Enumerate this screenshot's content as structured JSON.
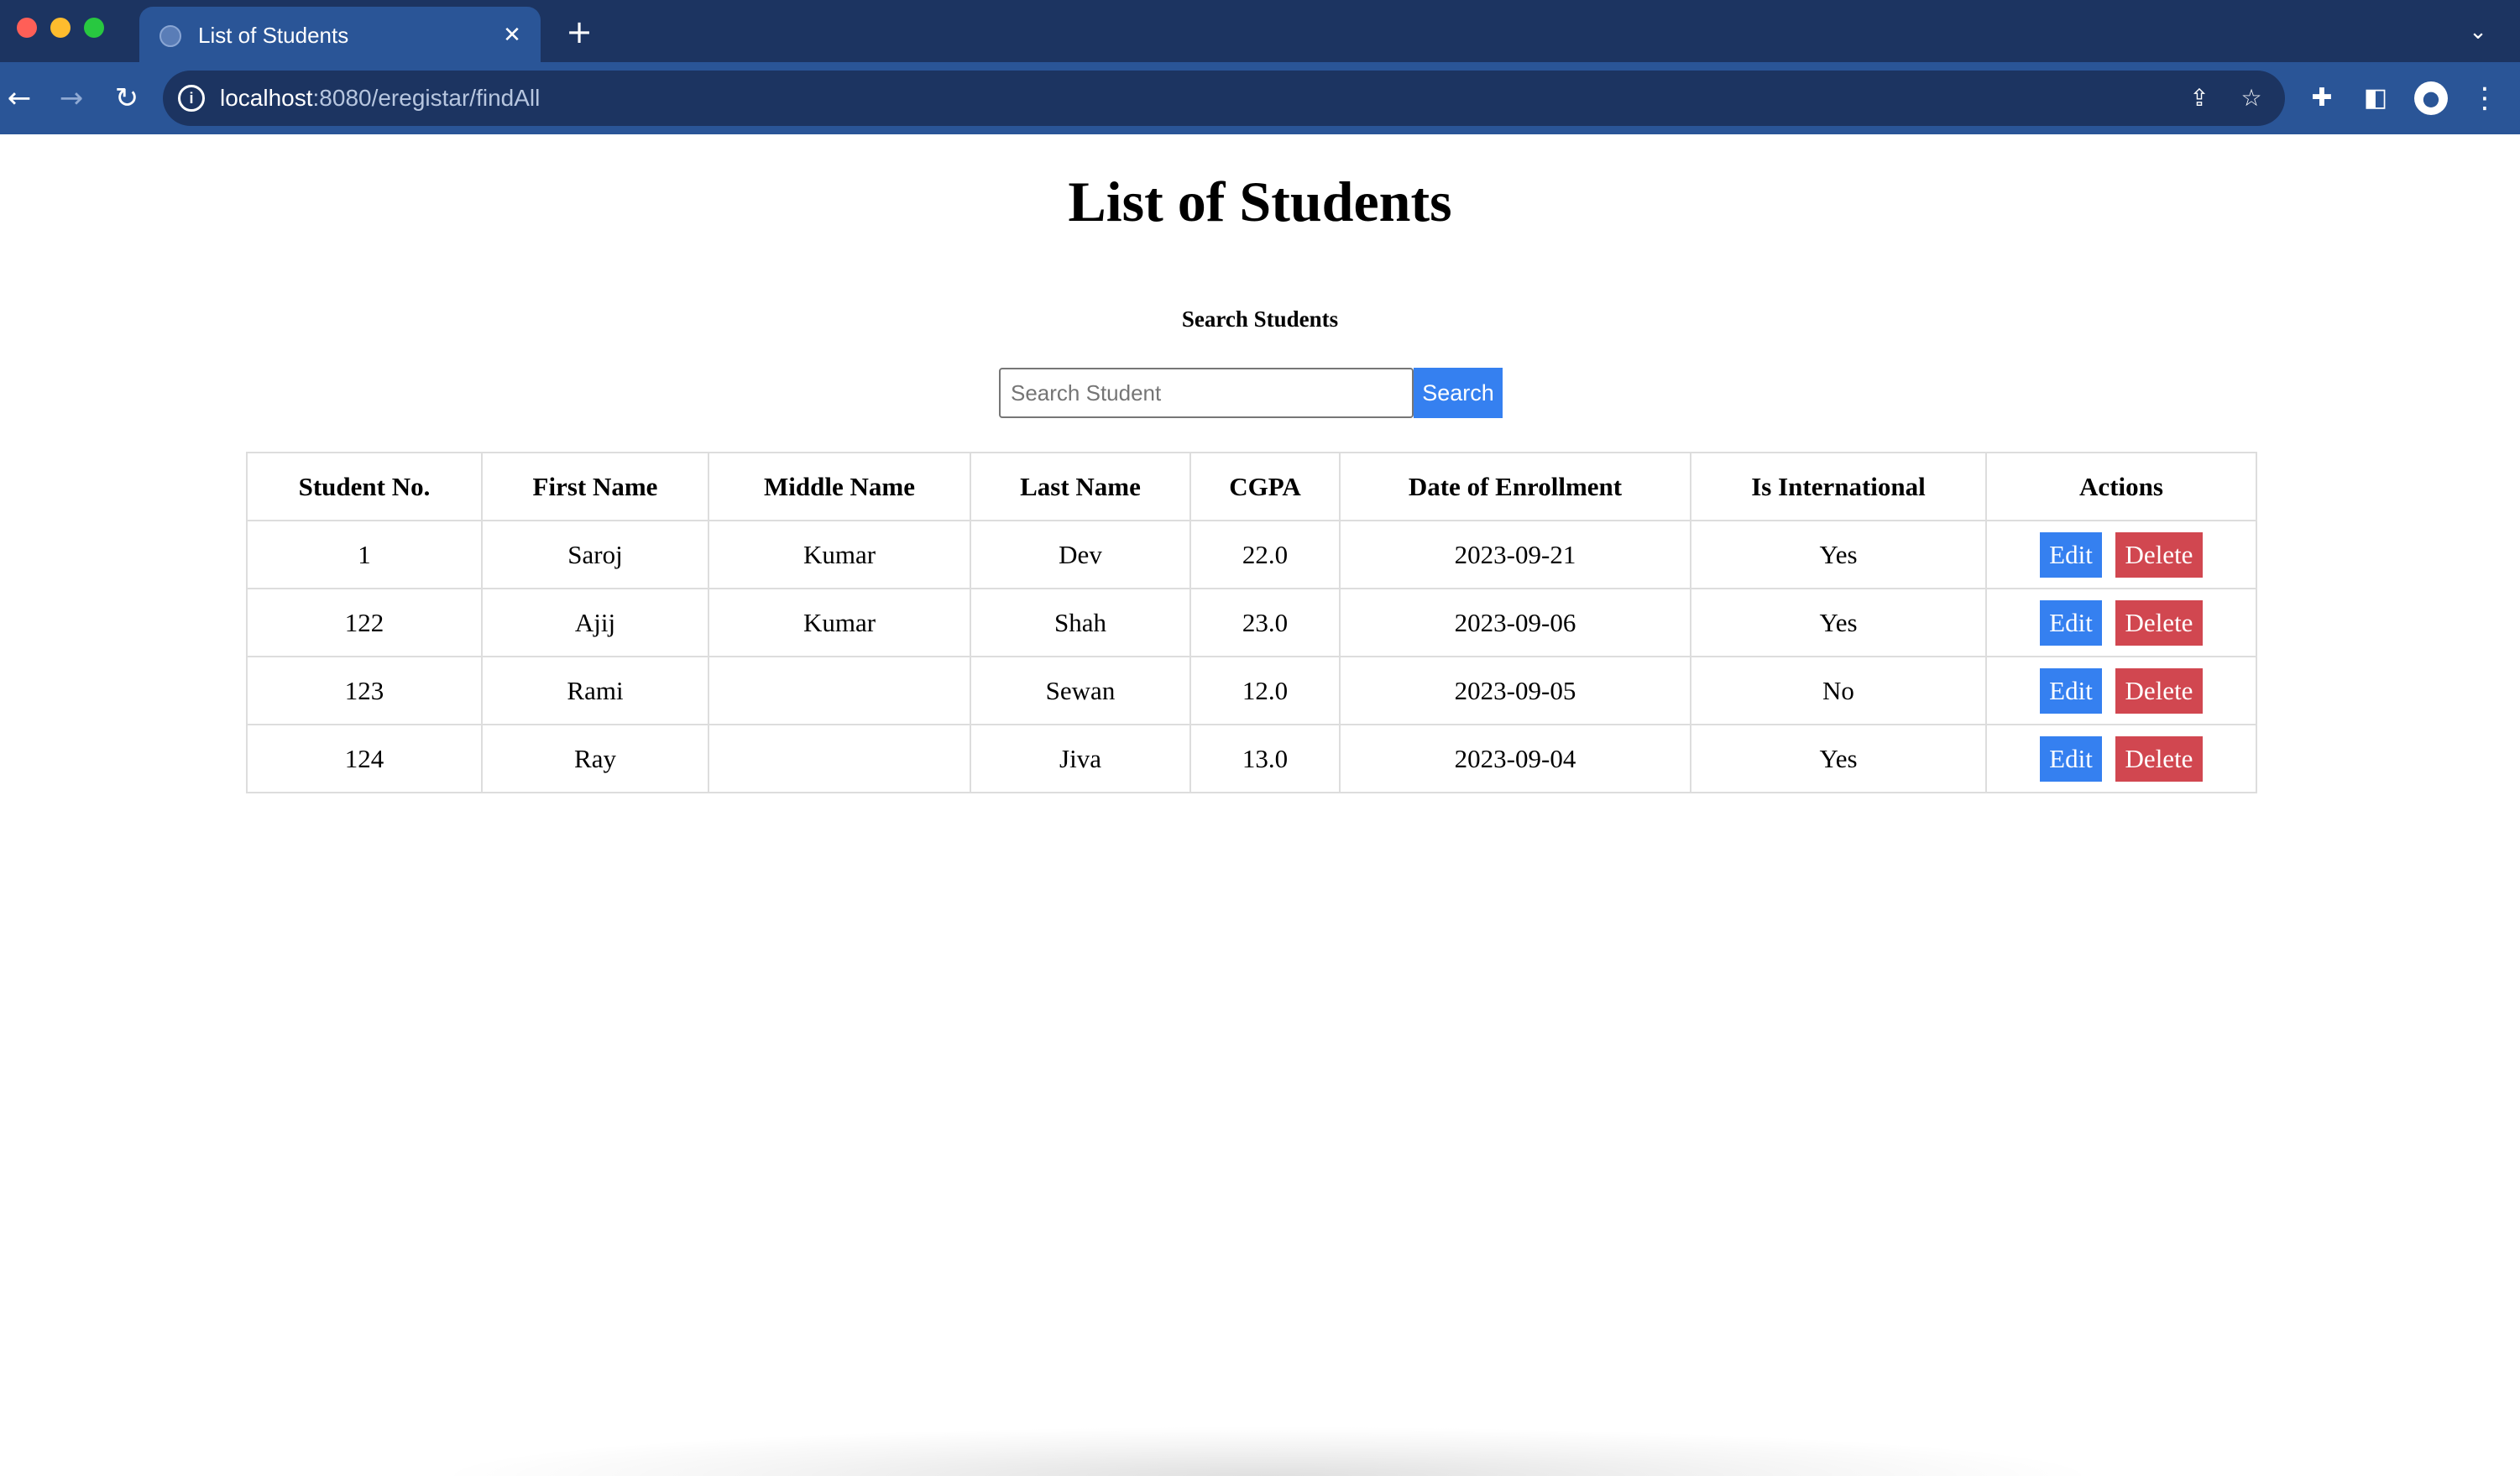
{
  "browser": {
    "tab_title": "List of Students",
    "url_host": "localhost",
    "url_rest": ":8080/eregistar/findAll",
    "tab_close_glyph": "✕",
    "new_tab_glyph": "+",
    "icons": [
      "back-arrow-icon",
      "forward-arrow-icon",
      "reload-icon",
      "site-info-icon",
      "share-icon",
      "star-icon",
      "extensions-icon",
      "side-panel-icon",
      "profile-icon",
      "menu-icon",
      "tab-list-chevron-icon"
    ]
  },
  "page": {
    "title": "List of Students",
    "search_heading": "Search Students",
    "search_placeholder": "Search Student",
    "search_value": "",
    "search_button": "Search"
  },
  "table": {
    "headers": [
      "Student No.",
      "First Name",
      "Middle Name",
      "Last Name",
      "CGPA",
      "Date of Enrollment",
      "Is International",
      "Actions"
    ],
    "edit_label": "Edit",
    "delete_label": "Delete",
    "rows": [
      {
        "student_no": "1",
        "first_name": "Saroj",
        "middle_name": "Kumar",
        "last_name": "Dev",
        "cgpa": "22.0",
        "date_of_enrollment": "2023-09-21",
        "is_international": "Yes"
      },
      {
        "student_no": "122",
        "first_name": "Ajij",
        "middle_name": "Kumar",
        "last_name": "Shah",
        "cgpa": "23.0",
        "date_of_enrollment": "2023-09-06",
        "is_international": "Yes"
      },
      {
        "student_no": "123",
        "first_name": "Rami",
        "middle_name": "",
        "last_name": "Sewan",
        "cgpa": "12.0",
        "date_of_enrollment": "2023-09-05",
        "is_international": "No"
      },
      {
        "student_no": "124",
        "first_name": "Ray",
        "middle_name": "",
        "last_name": "Jiva",
        "cgpa": "13.0",
        "date_of_enrollment": "2023-09-04",
        "is_international": "Yes"
      }
    ]
  },
  "colors": {
    "tabbar_bg": "#1c3461",
    "toolbar_bg": "#2a5597",
    "edit_button": "#3580f0",
    "delete_button": "#d14750",
    "search_button": "#3580f0"
  }
}
